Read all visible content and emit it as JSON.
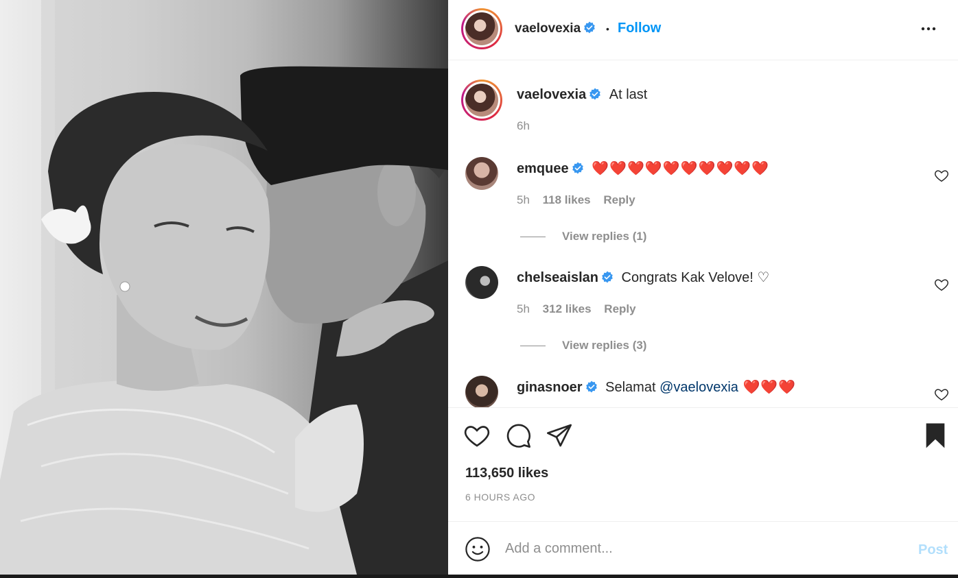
{
  "post": {
    "author": "vaelovexia",
    "follow_label": "Follow",
    "separator": "•",
    "caption_user": "vaelovexia",
    "caption_text": "At last",
    "caption_time": "6h"
  },
  "comments": [
    {
      "user": "emquee",
      "text": "❤️❤️❤️❤️❤️❤️❤️❤️❤️❤️",
      "time": "5h",
      "likes": "118 likes",
      "reply": "Reply",
      "view_replies": "View replies (1)"
    },
    {
      "user": "chelseaislan",
      "text": "Congrats Kak Velove! ♡",
      "time": "5h",
      "likes": "312 likes",
      "reply": "Reply",
      "view_replies": "View replies (3)"
    },
    {
      "user": "ginasnoer",
      "text_prefix": "Selamat ",
      "mention": "@vaelovexia",
      "text_suffix": " ❤️❤️❤️"
    }
  ],
  "actions": {
    "likes_count": "113,650 likes",
    "posted_ago": "6 HOURS AGO"
  },
  "comment_box": {
    "placeholder": "Add a comment...",
    "post_label": "Post"
  },
  "icons": {
    "verified": "verified-badge-icon",
    "more": "more-options-icon",
    "like": "heart-icon",
    "comment": "comment-bubble-icon",
    "share": "paper-plane-icon",
    "save": "bookmark-icon",
    "emoji": "emoji-smile-icon"
  },
  "colors": {
    "link_blue": "#0095f6",
    "verified_blue": "#3897f0",
    "post_disabled": "#b2dffc"
  }
}
